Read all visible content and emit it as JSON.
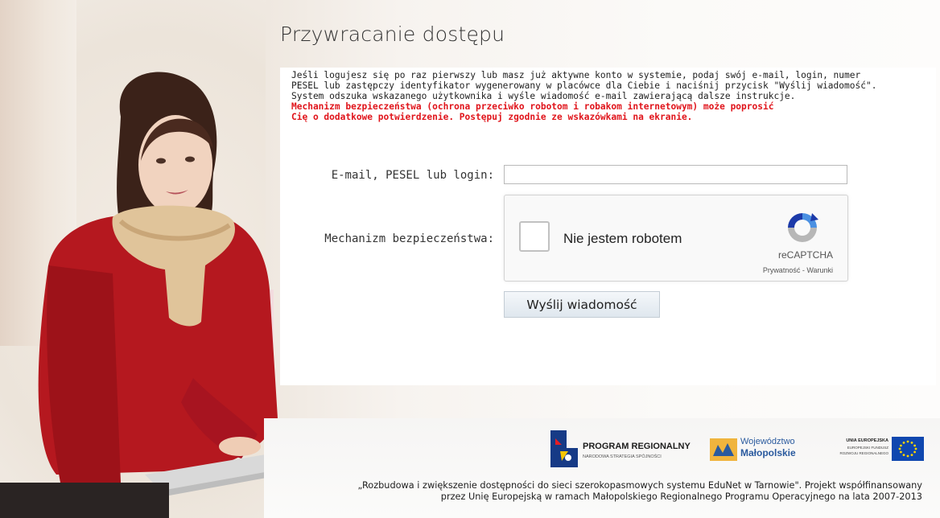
{
  "title": "Przywracanie dostępu",
  "intro": {
    "line1": "Jeśli logujesz się po raz pierwszy lub masz już aktywne konto w systemie, podaj swój e-mail, login, numer",
    "line2": "PESEL lub zastępczy identyfikator wygenerowany w placówce dla Ciebie i naciśnij przycisk \"Wyślij wiadomość\".",
    "line3": "System odszuka wskazanego użytkownika i wyśle wiadomość e-mail zawierającą dalsze instrukcje.",
    "warn1": "Mechanizm bezpieczeństwa (ochrona przeciwko robotom i robakom internetowym) może poprosić",
    "warn2": "Cię o dodatkowe potwierdzenie. Postępuj zgodnie ze wskazówkami na ekranie."
  },
  "form": {
    "email_label": "E-mail, PESEL lub login:",
    "email_value": "",
    "security_label": "Mechanizm bezpieczeństwa:",
    "send_label": "Wyślij wiadomość"
  },
  "captcha": {
    "checkbox_label": "Nie jestem robotem",
    "brand": "reCAPTCHA",
    "links": "Prywatność - Warunki"
  },
  "logos": {
    "program_title": "PROGRAM REGIONALNY",
    "program_sub": "NARODOWA STRATEGIA SPÓJNOŚCI",
    "woj_line1": "Województwo",
    "woj_line2": "Małopolskie",
    "eu_line1": "UNIA EUROPEJSKA",
    "eu_line2": "EUROPEJSKI FUNDUSZ",
    "eu_line3": "ROZWOJU REGIONALNEGO"
  },
  "footer": {
    "line1": "„Rozbudowa i zwiększenie dostępności do sieci szerokopasmowych systemu EduNet w Tarnowie\". Projekt współfinansowany",
    "line2": "przez Unię Europejską w ramach Małopolskiego Regionalnego Programu Operacyjnego na lata 2007-2013"
  },
  "colors": {
    "warning": "#e0141b",
    "text": "#1e1e1e",
    "eu_blue": "#0f47af",
    "eu_star": "#ffd500"
  }
}
